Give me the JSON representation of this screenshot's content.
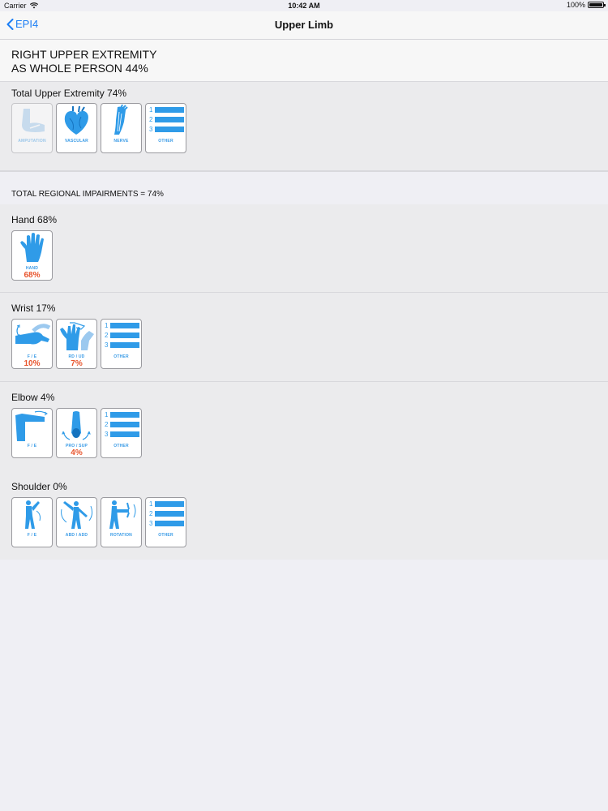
{
  "status": {
    "carrier": "Carrier",
    "time": "10:42 AM",
    "battery": "100%"
  },
  "nav": {
    "back_label": "EPI4",
    "title": "Upper Limb"
  },
  "header": {
    "line1": "RIGHT UPPER EXTREMITY",
    "line2": "AS WHOLE PERSON 44%"
  },
  "total": {
    "title": "Total Upper Extremity  74%",
    "tiles": [
      {
        "caption": "AMPUTATION",
        "icon": "amputation-icon",
        "enabled": false
      },
      {
        "caption": "VASCULAR",
        "icon": "heart-icon",
        "enabled": true
      },
      {
        "caption": "NERVE",
        "icon": "nerve-arm-icon",
        "enabled": true
      },
      {
        "caption": "OTHER",
        "icon": "numbered-list-icon",
        "enabled": true
      }
    ]
  },
  "regional": {
    "label": "TOTAL REGIONAL IMPAIRMENTS = 74%"
  },
  "hand": {
    "title": "Hand  68%",
    "tiles": [
      {
        "caption": "HAND",
        "value": "68%",
        "icon": "hand-icon"
      }
    ]
  },
  "wrist": {
    "title": "Wrist  17%",
    "tiles": [
      {
        "caption": "F / E",
        "value": "10%",
        "icon": "wrist-flex-icon"
      },
      {
        "caption": "RD / UD",
        "value": "7%",
        "icon": "wrist-deviation-icon"
      },
      {
        "caption": "OTHER",
        "value": "",
        "icon": "numbered-list-icon"
      }
    ]
  },
  "elbow": {
    "title": "Elbow  4%",
    "tiles": [
      {
        "caption": "F / E",
        "value": "",
        "icon": "elbow-flex-icon"
      },
      {
        "caption": "PRO / SUP",
        "value": "4%",
        "icon": "forearm-rotation-icon"
      },
      {
        "caption": "OTHER",
        "value": "",
        "icon": "numbered-list-icon"
      }
    ]
  },
  "shoulder": {
    "title": "Shoulder  0%",
    "tiles": [
      {
        "caption": "F / E",
        "value": "",
        "icon": "shoulder-flex-icon"
      },
      {
        "caption": "ABD / ADD",
        "value": "",
        "icon": "shoulder-abduction-icon"
      },
      {
        "caption": "ROTATION",
        "value": "",
        "icon": "shoulder-rotation-icon"
      },
      {
        "caption": "OTHER",
        "value": "",
        "icon": "numbered-list-icon"
      }
    ]
  },
  "list_numbers": [
    "1",
    "2",
    "3"
  ],
  "colors": {
    "accent": "#1b7ef5",
    "icon_blue": "#2f9be8",
    "value_red": "#e8542c"
  }
}
